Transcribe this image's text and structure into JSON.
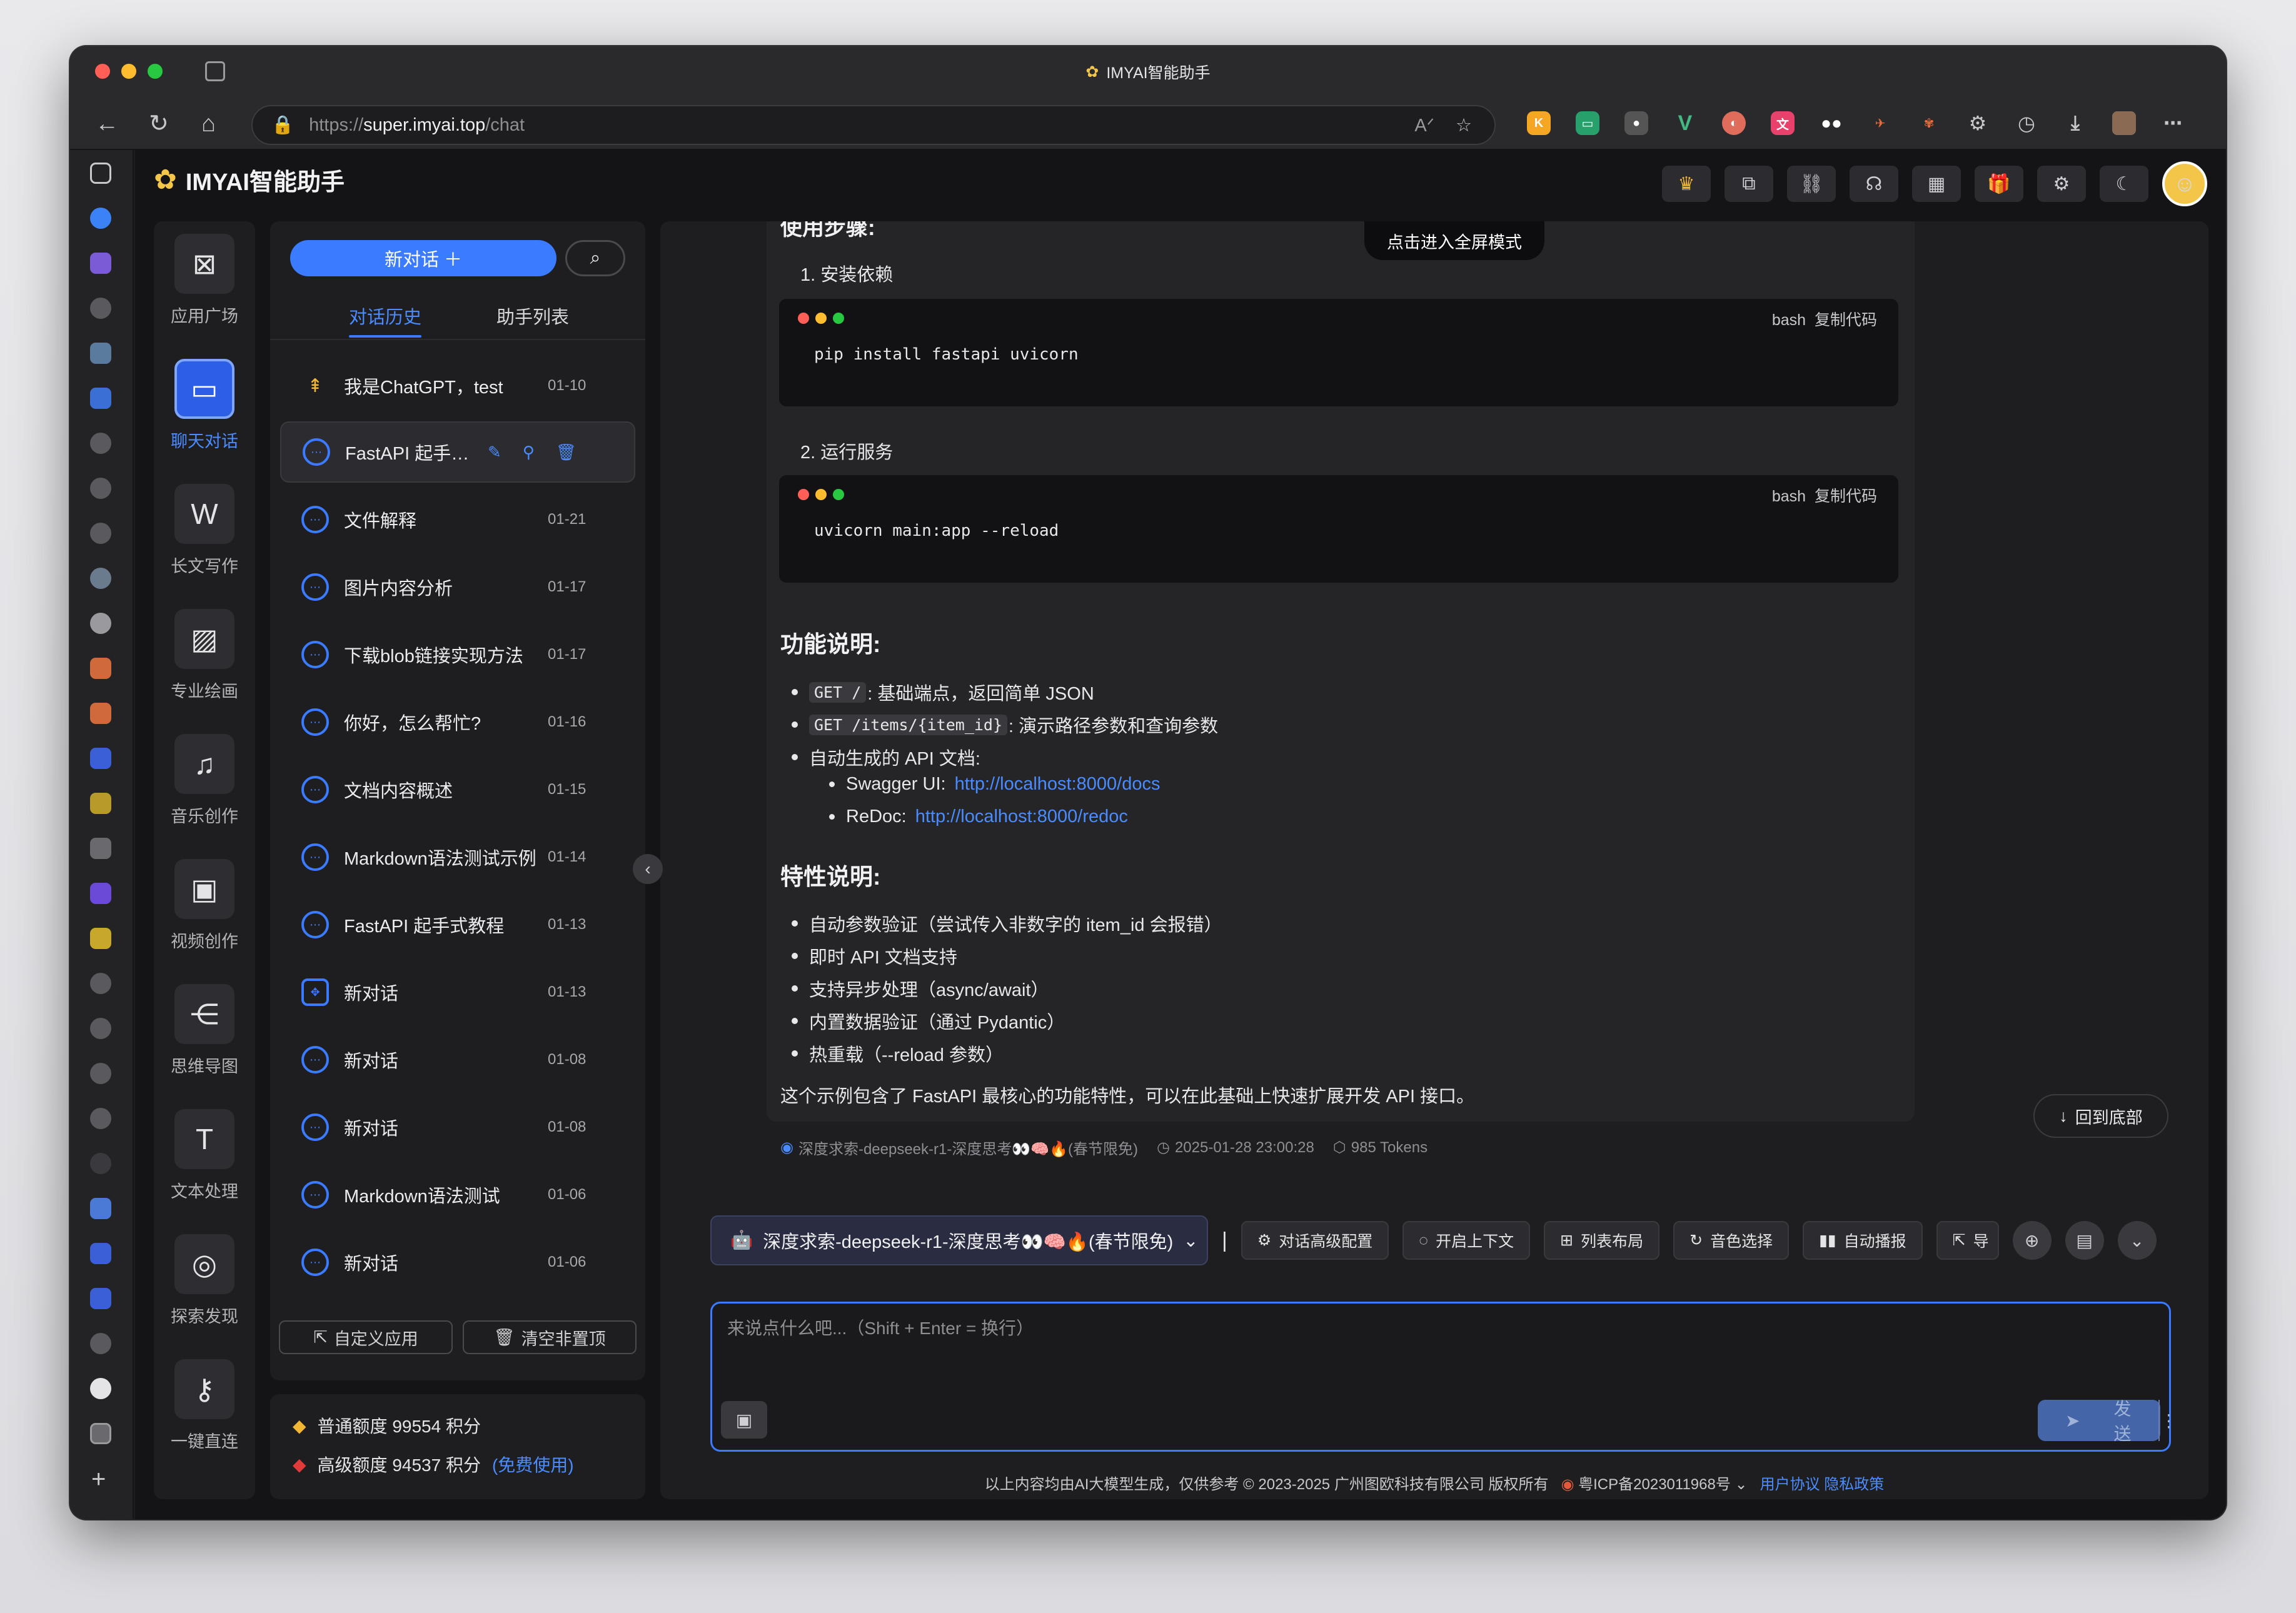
{
  "browser": {
    "window_title": "IMYAI智能助手",
    "url_scheme": "https://",
    "url_host": "super.imyai.top",
    "url_path": "/chat"
  },
  "app": {
    "name": "IMYAI智能助手"
  },
  "rail": {
    "items": [
      {
        "label": "应用广场",
        "icon": "app-grid-icon"
      },
      {
        "label": "聊天对话",
        "icon": "chat-icon",
        "active": true
      },
      {
        "label": "长文写作",
        "icon": "word-doc-icon"
      },
      {
        "label": "专业绘画",
        "icon": "image-icon"
      },
      {
        "label": "音乐创作",
        "icon": "music-icon"
      },
      {
        "label": "视频创作",
        "icon": "video-icon"
      },
      {
        "label": "思维导图",
        "icon": "mindmap-icon"
      },
      {
        "label": "文本处理",
        "icon": "text-icon"
      },
      {
        "label": "探索发现",
        "icon": "planet-icon"
      },
      {
        "label": "一键直连",
        "icon": "key-icon"
      }
    ]
  },
  "history": {
    "new_chat_label": "新对话 ＋",
    "tabs": [
      "对话历史",
      "助手列表"
    ],
    "items": [
      {
        "title": "我是ChatGPT，test",
        "date": "01-10",
        "pinned": true
      },
      {
        "title": "FastAPI 起手式...",
        "date": "",
        "selected": true
      },
      {
        "title": "文件解释",
        "date": "01-21"
      },
      {
        "title": "图片内容分析",
        "date": "01-17"
      },
      {
        "title": "下载blob链接实现方法",
        "date": "01-17"
      },
      {
        "title": "你好，怎么帮忙?",
        "date": "01-16"
      },
      {
        "title": "文档内容概述",
        "date": "01-15"
      },
      {
        "title": "Markdown语法测试示例",
        "date": "01-14"
      },
      {
        "title": "FastAPI 起手式教程",
        "date": "01-13"
      },
      {
        "title": "新对话",
        "date": "01-13"
      },
      {
        "title": "新对话",
        "date": "01-08"
      },
      {
        "title": "新对话",
        "date": "01-08"
      },
      {
        "title": "Markdown语法测试",
        "date": "01-06"
      },
      {
        "title": "新对话",
        "date": "01-06"
      }
    ],
    "custom_app_label": "自定义应用",
    "clear_label": "清空非置顶"
  },
  "quota": {
    "normal": "普通额度 99554 积分",
    "premium": "高级额度 94537 积分",
    "free_note": "(免费使用)"
  },
  "chat": {
    "fullscreen_label": "点击进入全屏模式",
    "cut_heading": "使用步骤:",
    "step1": "1. 安装依赖",
    "code1_lang": "bash",
    "copy_label": "复制代码",
    "code1": "pip install fastapi uvicorn",
    "step2": "2. 运行服务",
    "code2_lang": "bash",
    "code2": "uvicorn main:app --reload",
    "features_title": "功能说明:",
    "feature1_code": "GET /",
    "feature1_text": ": 基础端点，返回简单 JSON",
    "feature2_code": "GET /items/{item_id}",
    "feature2_text": ": 演示路径参数和查询参数",
    "feature3": "自动生成的 API 文档:",
    "swagger_label": "Swagger UI:",
    "swagger_url": "http://localhost:8000/docs",
    "redoc_label": "ReDoc:",
    "redoc_url": "http://localhost:8000/redoc",
    "traits_title": "特性说明:",
    "traits": [
      "自动参数验证（尝试传入非数字的 item_id 会报错）",
      "即时 API 文档支持",
      "支持异步处理（async/await）",
      "内置数据验证（通过 Pydantic）",
      "热重载（--reload 参数）"
    ],
    "summary": "这个示例包含了 FastAPI 最核心的功能特性，可以在此基础上快速扩展开发 API 接口。",
    "meta_model": "深度求索-deepseek-r1-深度思考👀🧠🔥(春节限免)",
    "meta_time": "2025-01-28 23:00:28",
    "meta_tokens": "985 Tokens",
    "to_bottom_label": "回到底部"
  },
  "toolbar": {
    "model": "深度求索-deepseek-r1-深度思考👀🧠🔥(春节限免)",
    "buttons": [
      "对话高级配置",
      "开启上下文",
      "列表布局",
      "音色选择",
      "自动播报",
      "导"
    ]
  },
  "input": {
    "placeholder": "来说点什么吧...（Shift + Enter = 换行）",
    "send_label": "发送"
  },
  "footer": {
    "text": "以上内容均由AI大模型生成，仅供参考 © 2023-2025 广州图欧科技有限公司 版权所有",
    "icp": "粤ICP备2023011968号",
    "links": "用户协议 隐私政策"
  }
}
